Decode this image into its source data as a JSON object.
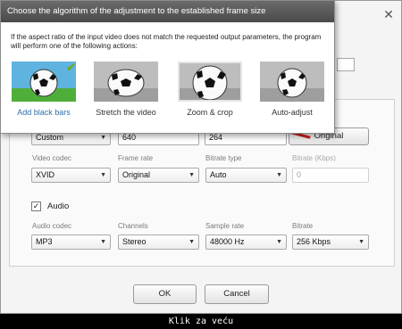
{
  "popup": {
    "title": "Choose the algorithm of the adjustment to the established frame size",
    "description": "If the aspect ratio of the input video does not match the requested output parameters, the program will perform one of the following actions:",
    "options": [
      {
        "label": "Add black bars",
        "selected": true
      },
      {
        "label": "Stretch the video",
        "selected": false
      },
      {
        "label": "Zoom & crop",
        "selected": false
      },
      {
        "label": "Auto-adjust",
        "selected": false
      }
    ]
  },
  "video": {
    "size_preset": "Custom",
    "width": "640",
    "height": "264",
    "original_button": "Original",
    "codec_label": "Video codec",
    "codec_value": "XVID",
    "frame_rate_label": "Frame rate",
    "frame_rate_value": "Original",
    "bitrate_type_label": "Bitrate type",
    "bitrate_type_value": "Auto",
    "bitrate_label": "Bitrate (Kbps)",
    "bitrate_value": "0"
  },
  "audio": {
    "checkbox_label": "Audio",
    "checked": true,
    "codec_label": "Audio codec",
    "codec_value": "MP3",
    "channels_label": "Channels",
    "channels_value": "Stereo",
    "sample_rate_label": "Sample rate",
    "sample_rate_value": "48000 Hz",
    "bitrate_label": "Bitrate",
    "bitrate_value": "256 Kbps"
  },
  "buttons": {
    "ok": "OK",
    "cancel": "Cancel"
  },
  "footer": "Klik za veću",
  "icons": {
    "close": "close-icon",
    "dropdown": "chevron-down-icon",
    "check": "checkmark-icon"
  },
  "colors": {
    "link_blue": "#2d6fa8",
    "arrow_red": "#cc1e1e",
    "header_bg": "#555555",
    "check_green": "#6cab2a"
  }
}
